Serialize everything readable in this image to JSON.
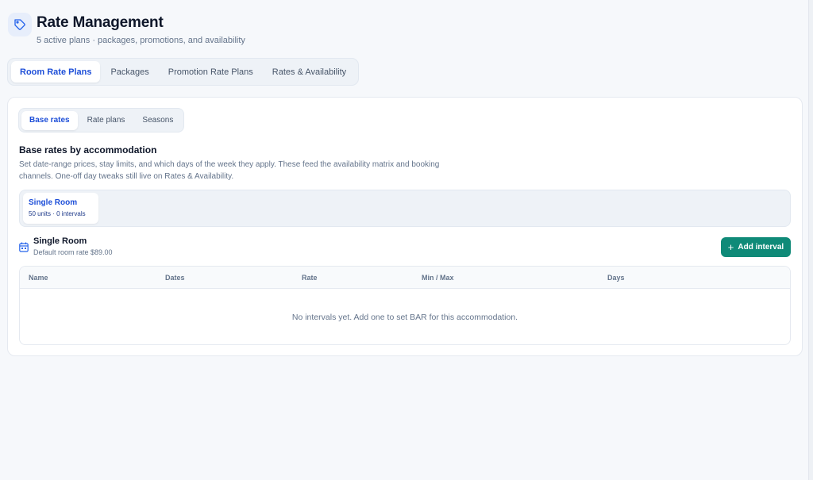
{
  "header": {
    "title": "Rate Management",
    "subtitle": "5 active plans · packages, promotions, and availability",
    "icon": "tag-icon"
  },
  "main_tabs": [
    {
      "label": "Room Rate Plans",
      "active": true
    },
    {
      "label": "Packages",
      "active": false
    },
    {
      "label": "Promotion Rate Plans",
      "active": false
    },
    {
      "label": "Rates & Availability",
      "active": false
    }
  ],
  "sub_tabs": [
    {
      "label": "Base rates",
      "active": true
    },
    {
      "label": "Rate plans",
      "active": false
    },
    {
      "label": "Seasons",
      "active": false
    }
  ],
  "section": {
    "title": "Base rates by accommodation",
    "description": "Set date-range prices, stay limits, and which days of the week they apply. These feed the availability matrix and booking channels. One-off day tweaks still live on Rates & Availability."
  },
  "accommodations": [
    {
      "name": "Single Room",
      "meta": "50 units · 0 intervals",
      "selected": true
    }
  ],
  "selected_room": {
    "name": "Single Room",
    "default_rate": "Default room rate $89.00",
    "icon": "calendar-icon"
  },
  "add_button": {
    "label": "Add interval",
    "icon": "plus-icon"
  },
  "table": {
    "columns": [
      "Name",
      "Dates",
      "Rate",
      "Min / Max",
      "Days"
    ],
    "empty_message": "No intervals yet. Add one to set BAR for this accommodation."
  },
  "colors": {
    "accent": "#1d4ed8",
    "primary_button": "#0f8a78",
    "background": "#f6f8fb"
  }
}
